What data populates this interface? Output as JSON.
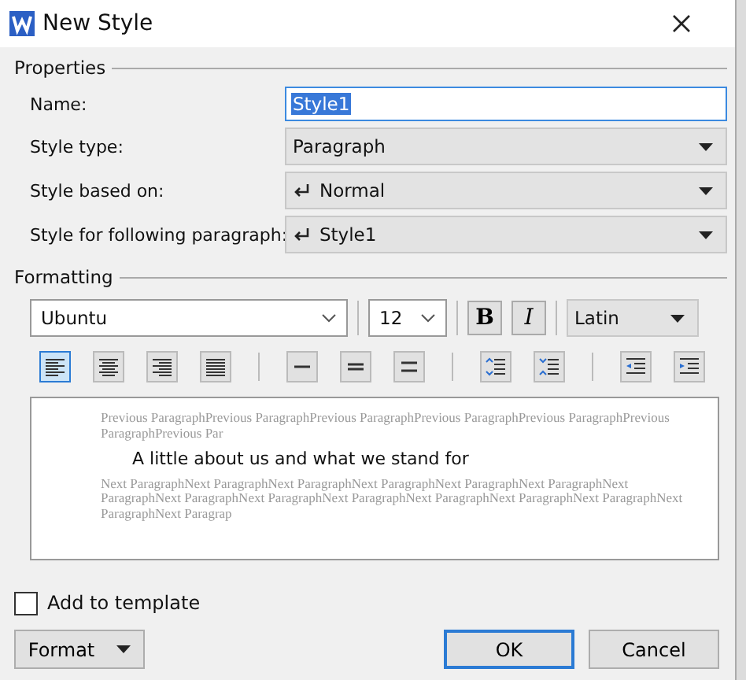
{
  "window": {
    "title": "New Style"
  },
  "properties": {
    "legend": "Properties",
    "fields": [
      {
        "kind": "text",
        "label": "Name:",
        "value": "Style1"
      },
      {
        "kind": "dropdown",
        "label": "Style type:",
        "value": "Paragraph"
      },
      {
        "kind": "style-dropdown",
        "label": "Style based on:",
        "value": "Normal"
      },
      {
        "kind": "style-dropdown",
        "label": "Style for following paragraph:",
        "value": "Style1"
      }
    ]
  },
  "formatting": {
    "legend": "Formatting",
    "font": "Ubuntu",
    "size": "12",
    "bold": {
      "label": "B",
      "on": false
    },
    "italic": {
      "label": "I",
      "on": false
    },
    "script": "Latin",
    "paragraph_groups": [
      [
        {
          "kind": "align-left",
          "selected": true
        },
        {
          "kind": "align-center",
          "selected": false
        },
        {
          "kind": "align-right",
          "selected": false
        },
        {
          "kind": "justify",
          "selected": false
        }
      ],
      [
        {
          "kind": "single",
          "selected": false
        },
        {
          "kind": "one-half",
          "selected": false
        },
        {
          "kind": "double",
          "selected": false
        }
      ],
      [
        {
          "kind": "space-before",
          "selected": false
        },
        {
          "kind": "space-after",
          "selected": false
        }
      ],
      [
        {
          "kind": "indent-less",
          "selected": false
        },
        {
          "kind": "indent-more",
          "selected": false
        }
      ]
    ]
  },
  "preview": {
    "previous": "Previous ParagraphPrevious ParagraphPrevious ParagraphPrevious ParagraphPrevious ParagraphPrevious ParagraphPrevious Par",
    "sample": "A little  about us and what we stand  for",
    "next": "Next ParagraphNext ParagraphNext ParagraphNext ParagraphNext ParagraphNext ParagraphNext ParagraphNext ParagraphNext ParagraphNext ParagraphNext ParagraphNext ParagraphNext ParagraphNext ParagraphNext Paragrap"
  },
  "add_to_template": {
    "label": "Add to template",
    "checked": false
  },
  "buttons": [
    {
      "kind": "menu",
      "label": "Format"
    },
    {
      "kind": "default",
      "label": "OK"
    },
    {
      "kind": "plain",
      "label": "Cancel"
    }
  ]
}
